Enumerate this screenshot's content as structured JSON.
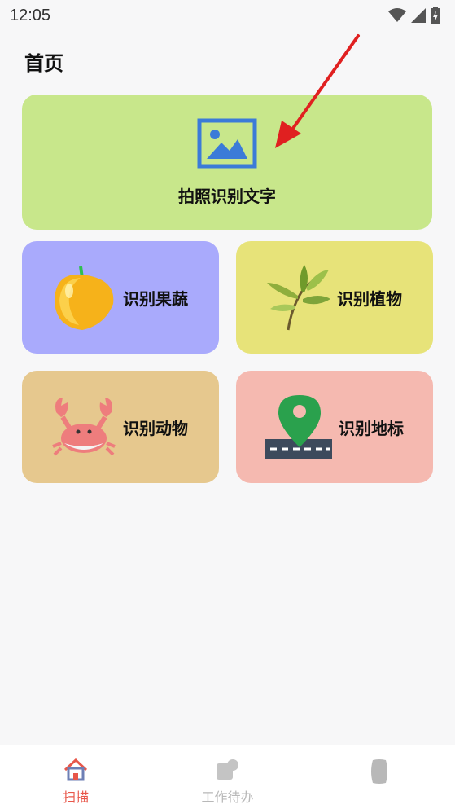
{
  "status_bar": {
    "time": "12:05",
    "icons": [
      "wifi-icon",
      "signal-icon",
      "battery-charging-icon"
    ]
  },
  "page": {
    "title": "首页"
  },
  "cards": {
    "text_recognition": {
      "label": "拍照识别文字",
      "icon": "image-icon",
      "color": "#c8e78b"
    },
    "fruit_veg": {
      "label": "识别果蔬",
      "icon": "fruit-icon",
      "color": "#a9aafc"
    },
    "plant": {
      "label": "识别植物",
      "icon": "plant-icon",
      "color": "#e7e379"
    },
    "animal": {
      "label": "识别动物",
      "icon": "crab-icon",
      "color": "#e6c88e"
    },
    "landmark": {
      "label": "识别地标",
      "icon": "map-pin-icon",
      "color": "#f5b9b0"
    }
  },
  "bottom_nav": {
    "items": [
      {
        "label": "扫描",
        "icon": "home-icon",
        "active": true
      },
      {
        "label": "工作待办",
        "icon": "todo-icon",
        "active": false
      },
      {
        "label": "",
        "icon": "profile-icon",
        "active": false
      }
    ],
    "active_color": "#e8574a",
    "inactive_color": "#b8b8b8"
  },
  "annotation": {
    "icon": "red-arrow-icon",
    "color": "#e02020"
  }
}
